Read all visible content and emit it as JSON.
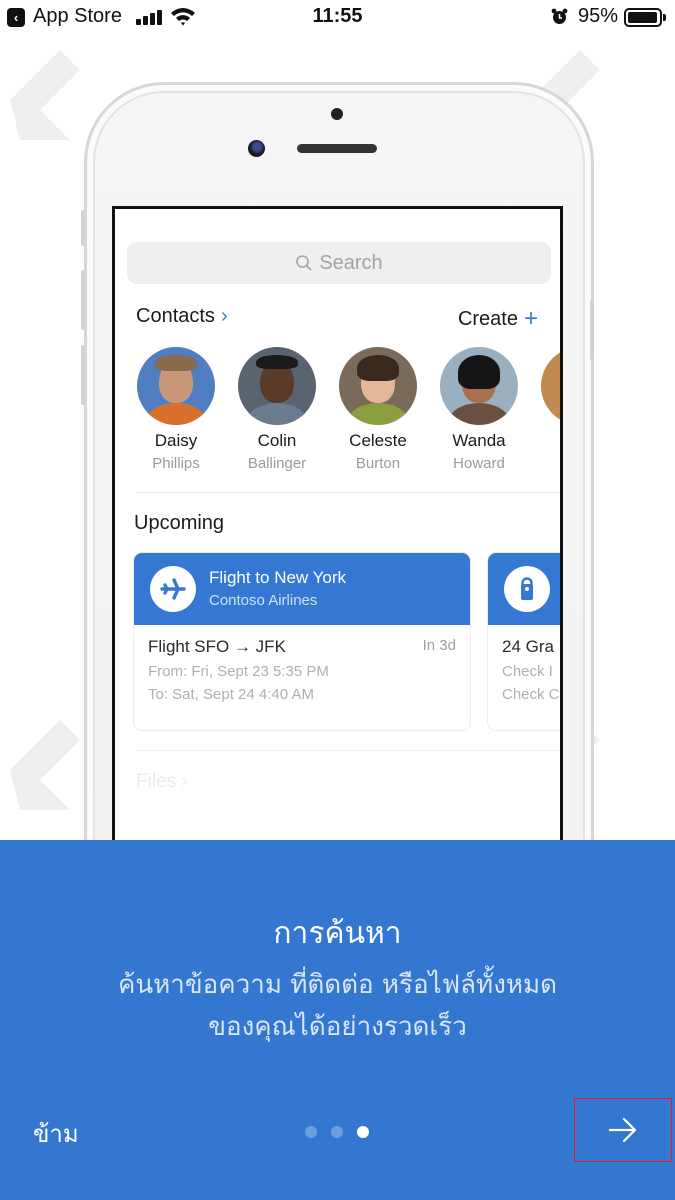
{
  "status_bar": {
    "back_app": "App Store",
    "time": "11:55",
    "battery_percent": "95%",
    "battery_level": 0.95,
    "signal_bars": 4,
    "icons": [
      "back-icon",
      "signal-icon",
      "wifi-icon",
      "alarm-icon",
      "battery-icon"
    ]
  },
  "illustration": {
    "search_placeholder": "Search",
    "contacts_label": "Contacts",
    "contacts_chevron": "›",
    "create_label": "Create",
    "create_plus": "+",
    "contacts": [
      {
        "first": "Daisy",
        "last": "Phillips"
      },
      {
        "first": "Colin",
        "last": "Ballinger"
      },
      {
        "first": "Celeste",
        "last": "Burton"
      },
      {
        "first": "Wanda",
        "last": "Howard"
      }
    ],
    "upcoming_label": "Upcoming",
    "cards": [
      {
        "icon": "airplane-icon",
        "title": "Flight to New York",
        "subtitle": "Contoso Airlines",
        "line1": "Flight SFO → JFK",
        "when": "In 3d",
        "line2": "From: Fri, Sept 23 5:35 PM",
        "line3": "To: Sat, Sept 24 4:40 AM"
      },
      {
        "icon": "door-hanger-icon",
        "line1": "24 Gra",
        "line2": "Check I",
        "line3": "Check C"
      }
    ],
    "files_label": "Files",
    "files_chevron": "›"
  },
  "onboarding": {
    "title": "การค้นหา",
    "description_line1": "ค้นหาข้อความ ที่ติดต่อ หรือไฟล์ทั้งหมด",
    "description_line2": "ของคุณได้อย่างรวดเร็ว",
    "skip_label": "ข้าม",
    "page_count": 3,
    "current_page": 3,
    "next_icon": "arrow-right-icon"
  },
  "colors": {
    "panel_blue": "#3377d0",
    "accent_blue": "#3b7bd6",
    "highlight_red": "#d81f2a"
  }
}
